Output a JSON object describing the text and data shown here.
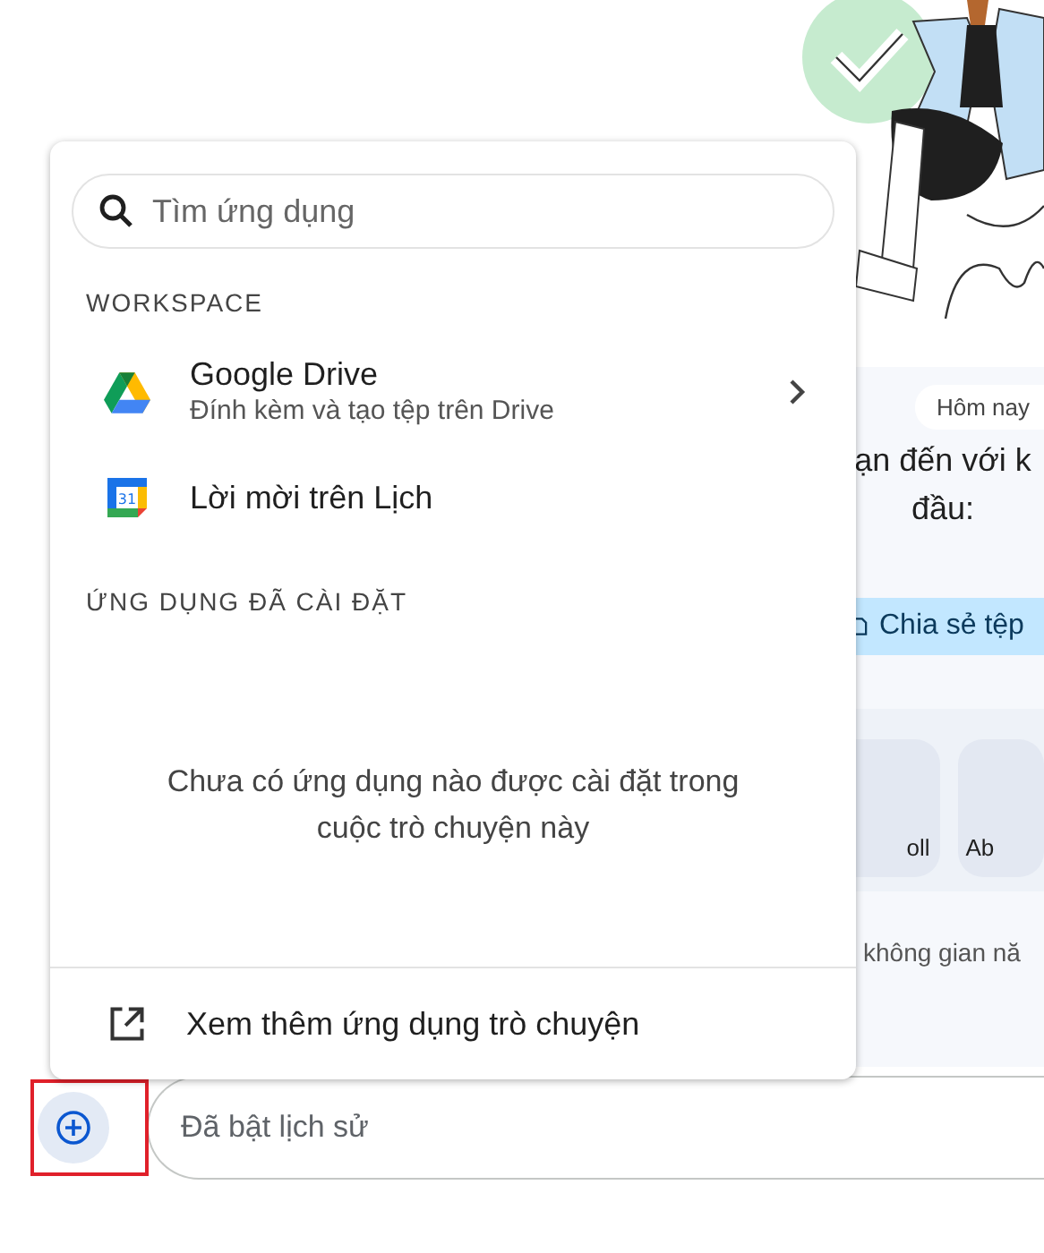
{
  "popup": {
    "search": {
      "placeholder": "Tìm ứng dụng"
    },
    "sections": [
      {
        "title": "WORKSPACE",
        "items": [
          {
            "kind": "drive",
            "title": "Google Drive",
            "subtitle": "Đính kèm và tạo tệp trên Drive",
            "has_submenu": true
          },
          {
            "kind": "calendar",
            "title": "Lời mời trên Lịch",
            "icon_text": "31",
            "has_submenu": false
          }
        ]
      },
      {
        "title": "ỨNG DỤNG ĐÃ CÀI ĐẶT",
        "empty_text": "Chưa có ứng dụng nào được cài đặt trong cuộc trò chuyện này"
      }
    ],
    "footer": {
      "label": "Xem thêm ứng dụng trò chuyện"
    }
  },
  "chat": {
    "date_chip": "Hôm nay",
    "welcome_lines": [
      "ạn đến với k",
      "đầu:"
    ],
    "share_button": "Chia sẻ tệp",
    "cards": [
      {
        "label": "oll"
      },
      {
        "label": "Ab"
      }
    ],
    "hint": "không gian nă"
  },
  "composer": {
    "add_button": {
      "highlighted": true
    },
    "placeholder": "Đã bật lịch sử"
  }
}
